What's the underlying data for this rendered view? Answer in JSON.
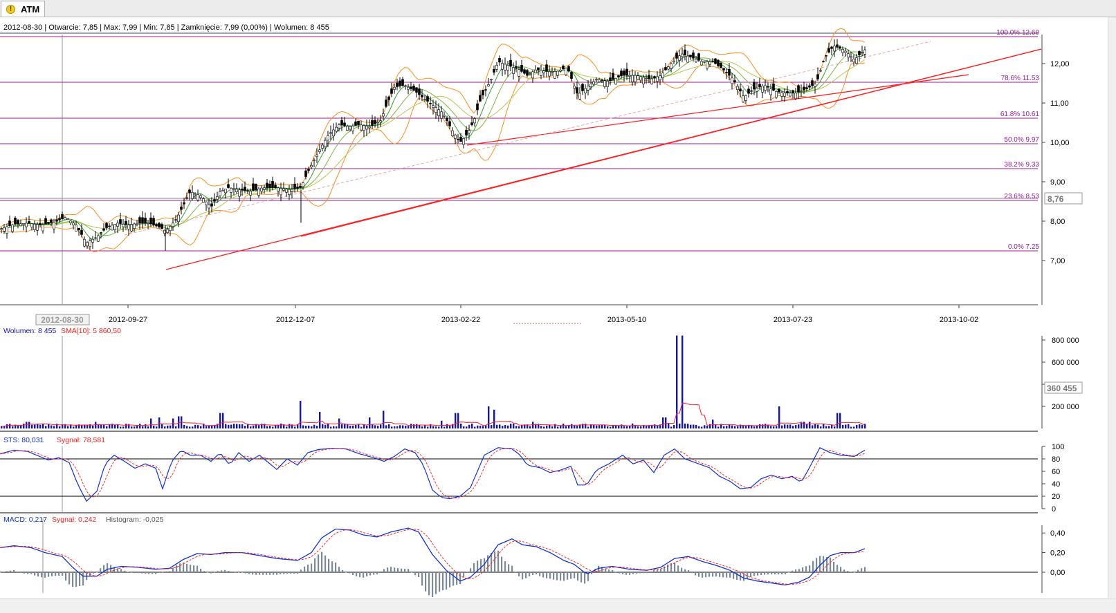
{
  "tab": {
    "label": "ATM",
    "icon": "warning-icon"
  },
  "info_bar": "2012-08-30 | Otwarcie: 7,85 | Max: 7,99 | Min: 7,85 | Zamknięcie: 7,99 (0,00%) | Wolumen: 8 455",
  "colors": {
    "fib": "#9b1b9b",
    "trend": "#ff2020",
    "bollinger": "#ff8c1a",
    "ma_fast": "#2aa02a",
    "ma_slow": "#b9c64b",
    "volume": "#1010d0",
    "sts": "#1030e0",
    "signal": "#ff2020",
    "histogram": "#7a8a9a"
  },
  "chart_data": [
    {
      "type": "candlestick",
      "price_axis_labels": [
        "12,00",
        "11,00",
        "10,00",
        "9,00",
        "8,00",
        "7,00"
      ],
      "current_price_label": "8,76",
      "ylim": [
        6.9,
        13.0
      ],
      "date_labels": [
        "2012-09-27",
        "2012-12-07",
        "2013-02-22",
        "2013-05-10",
        "2013-07-23",
        "2013-10-02"
      ],
      "cursor_date_label": "2012-08-30",
      "fibonacci": [
        {
          "label": "100.0% 12.69",
          "value": 12.69
        },
        {
          "label": "78.6% 11.53",
          "value": 11.53
        },
        {
          "label": "61.8% 10.61",
          "value": 10.61
        },
        {
          "label": "50.0% 9.97",
          "value": 9.97
        },
        {
          "label": "38.2% 9.33",
          "value": 9.33
        },
        {
          "label": "23.6% 8.53",
          "value": 8.53
        },
        {
          "label": "0.0% 7.25",
          "value": 7.25
        }
      ],
      "close_path": [
        [
          0,
          7.8
        ],
        [
          20,
          7.92
        ],
        [
          40,
          7.95
        ],
        [
          60,
          7.9
        ],
        [
          80,
          7.98
        ],
        [
          95,
          8.1
        ],
        [
          110,
          7.9
        ],
        [
          125,
          7.45
        ],
        [
          140,
          7.6
        ],
        [
          155,
          7.85
        ],
        [
          170,
          7.95
        ],
        [
          185,
          7.9
        ],
        [
          200,
          7.95
        ],
        [
          215,
          7.95
        ],
        [
          230,
          7.85
        ],
        [
          240,
          7.75
        ],
        [
          255,
          8.05
        ],
        [
          265,
          8.4
        ],
        [
          275,
          8.75
        ],
        [
          290,
          8.65
        ],
        [
          305,
          8.35
        ],
        [
          318,
          8.75
        ],
        [
          330,
          8.85
        ],
        [
          345,
          8.8
        ],
        [
          360,
          8.75
        ],
        [
          380,
          8.85
        ],
        [
          400,
          8.85
        ],
        [
          420,
          8.8
        ],
        [
          435,
          8.85
        ],
        [
          445,
          9.25
        ],
        [
          460,
          9.75
        ],
        [
          475,
          10.2
        ],
        [
          490,
          10.45
        ],
        [
          505,
          10.4
        ],
        [
          520,
          10.45
        ],
        [
          535,
          10.4
        ],
        [
          550,
          10.55
        ],
        [
          560,
          11.0
        ],
        [
          570,
          11.4
        ],
        [
          585,
          11.45
        ],
        [
          600,
          11.3
        ],
        [
          610,
          11.15
        ],
        [
          625,
          10.95
        ],
        [
          640,
          10.75
        ],
        [
          652,
          10.35
        ],
        [
          665,
          10.0
        ],
        [
          675,
          10.2
        ],
        [
          685,
          10.55
        ],
        [
          695,
          11.1
        ],
        [
          710,
          11.6
        ],
        [
          720,
          12.05
        ],
        [
          735,
          11.95
        ],
        [
          750,
          11.85
        ],
        [
          762,
          11.7
        ],
        [
          775,
          11.85
        ],
        [
          790,
          11.8
        ],
        [
          805,
          11.8
        ],
        [
          820,
          11.9
        ],
        [
          835,
          11.2
        ],
        [
          848,
          11.4
        ],
        [
          862,
          11.6
        ],
        [
          880,
          11.55
        ],
        [
          900,
          11.7
        ],
        [
          920,
          11.7
        ],
        [
          940,
          11.6
        ],
        [
          955,
          11.7
        ],
        [
          970,
          12.0
        ],
        [
          985,
          12.25
        ],
        [
          1000,
          12.15
        ],
        [
          1015,
          12.05
        ],
        [
          1030,
          12.05
        ],
        [
          1045,
          11.85
        ],
        [
          1060,
          11.6
        ],
        [
          1075,
          11.15
        ],
        [
          1090,
          11.35
        ],
        [
          1105,
          11.45
        ],
        [
          1120,
          11.3
        ],
        [
          1135,
          11.25
        ],
        [
          1150,
          11.25
        ],
        [
          1165,
          11.35
        ],
        [
          1180,
          11.5
        ],
        [
          1192,
          12.15
        ],
        [
          1205,
          12.45
        ],
        [
          1220,
          12.35
        ],
        [
          1235,
          12.1
        ],
        [
          1250,
          12.35
        ]
      ],
      "last_bar": {
        "date": "2012-08-30",
        "open": "7,85",
        "high": "7,99",
        "low": "7,85",
        "close": "7,99 (0,00%)"
      }
    },
    {
      "type": "bar",
      "title": "Wolumen: 8 455",
      "indicator": "SMA[10]: 5 860,50",
      "axis_labels": [
        "800 000",
        "600 000",
        "400 000",
        "200 000"
      ],
      "current_label": "360 455",
      "ylim": [
        0,
        800000
      ],
      "spikes": [
        [
          40,
          60000
        ],
        [
          95,
          40000
        ],
        [
          138,
          60000
        ],
        [
          218,
          90000
        ],
        [
          230,
          100000
        ],
        [
          250,
          90000
        ],
        [
          260,
          110000
        ],
        [
          320,
          140000
        ],
        [
          435,
          250000
        ],
        [
          462,
          150000
        ],
        [
          490,
          90000
        ],
        [
          535,
          100000
        ],
        [
          555,
          160000
        ],
        [
          638,
          70000
        ],
        [
          660,
          140000
        ],
        [
          705,
          200000
        ],
        [
          715,
          170000
        ],
        [
          770,
          60000
        ],
        [
          960,
          100000
        ],
        [
          977,
          840000
        ],
        [
          987,
          840000
        ],
        [
          1030,
          80000
        ],
        [
          1125,
          200000
        ],
        [
          1160,
          60000
        ],
        [
          1170,
          60000
        ],
        [
          1212,
          140000
        ]
      ]
    },
    {
      "type": "line",
      "title": "STS: 80,031",
      "signal": "Sygnał: 78,581",
      "axis_labels": [
        "100",
        "80",
        "60",
        "40",
        "20",
        "0"
      ],
      "ylim": [
        0,
        100
      ],
      "levels": [
        80,
        20
      ],
      "points": [
        [
          0,
          88
        ],
        [
          20,
          94
        ],
        [
          40,
          92
        ],
        [
          55,
          85
        ],
        [
          70,
          78
        ],
        [
          85,
          82
        ],
        [
          100,
          74
        ],
        [
          112,
          40
        ],
        [
          125,
          12
        ],
        [
          140,
          28
        ],
        [
          152,
          72
        ],
        [
          165,
          86
        ],
        [
          180,
          76
        ],
        [
          195,
          65
        ],
        [
          210,
          72
        ],
        [
          225,
          65
        ],
        [
          235,
          32
        ],
        [
          248,
          76
        ],
        [
          262,
          94
        ],
        [
          275,
          86
        ],
        [
          290,
          86
        ],
        [
          305,
          76
        ],
        [
          318,
          90
        ],
        [
          332,
          70
        ],
        [
          345,
          90
        ],
        [
          360,
          76
        ],
        [
          375,
          86
        ],
        [
          388,
          74
        ],
        [
          400,
          63
        ],
        [
          415,
          80
        ],
        [
          430,
          70
        ],
        [
          445,
          90
        ],
        [
          460,
          95
        ],
        [
          480,
          97
        ],
        [
          500,
          96
        ],
        [
          520,
          88
        ],
        [
          540,
          82
        ],
        [
          555,
          76
        ],
        [
          570,
          84
        ],
        [
          585,
          96
        ],
        [
          600,
          90
        ],
        [
          612,
          70
        ],
        [
          625,
          30
        ],
        [
          638,
          18
        ],
        [
          650,
          16
        ],
        [
          665,
          20
        ],
        [
          680,
          34
        ],
        [
          690,
          60
        ],
        [
          700,
          86
        ],
        [
          720,
          98
        ],
        [
          740,
          96
        ],
        [
          752,
          86
        ],
        [
          762,
          70
        ],
        [
          780,
          66
        ],
        [
          795,
          58
        ],
        [
          810,
          62
        ],
        [
          825,
          68
        ],
        [
          835,
          38
        ],
        [
          848,
          38
        ],
        [
          862,
          62
        ],
        [
          880,
          72
        ],
        [
          900,
          86
        ],
        [
          915,
          72
        ],
        [
          930,
          78
        ],
        [
          945,
          58
        ],
        [
          960,
          86
        ],
        [
          975,
          96
        ],
        [
          990,
          80
        ],
        [
          1010,
          72
        ],
        [
          1025,
          66
        ],
        [
          1040,
          52
        ],
        [
          1055,
          44
        ],
        [
          1070,
          32
        ],
        [
          1085,
          34
        ],
        [
          1100,
          48
        ],
        [
          1115,
          54
        ],
        [
          1130,
          48
        ],
        [
          1145,
          52
        ],
        [
          1158,
          42
        ],
        [
          1170,
          66
        ],
        [
          1185,
          98
        ],
        [
          1200,
          90
        ],
        [
          1215,
          86
        ],
        [
          1235,
          84
        ],
        [
          1250,
          94
        ]
      ]
    },
    {
      "type": "line",
      "title": "MACD: 0,217",
      "signal": "Sygnał: 0,242",
      "histogram": "Histogram: -0,025",
      "axis_labels": [
        "0,40",
        "0,20",
        "0,00"
      ],
      "ylim": [
        -0.15,
        0.45
      ],
      "points": [
        [
          0,
          0.25
        ],
        [
          20,
          0.27
        ],
        [
          45,
          0.25
        ],
        [
          65,
          0.2
        ],
        [
          90,
          0.16
        ],
        [
          105,
          0.05
        ],
        [
          120,
          -0.04
        ],
        [
          140,
          -0.04
        ],
        [
          155,
          0.03
        ],
        [
          175,
          0.06
        ],
        [
          200,
          0.05
        ],
        [
          225,
          0.03
        ],
        [
          245,
          0.04
        ],
        [
          265,
          0.13
        ],
        [
          285,
          0.19
        ],
        [
          305,
          0.18
        ],
        [
          325,
          0.2
        ],
        [
          350,
          0.2
        ],
        [
          375,
          0.17
        ],
        [
          400,
          0.14
        ],
        [
          430,
          0.12
        ],
        [
          450,
          0.2
        ],
        [
          465,
          0.35
        ],
        [
          485,
          0.44
        ],
        [
          505,
          0.43
        ],
        [
          525,
          0.38
        ],
        [
          545,
          0.36
        ],
        [
          565,
          0.41
        ],
        [
          590,
          0.45
        ],
        [
          605,
          0.41
        ],
        [
          625,
          0.18
        ],
        [
          645,
          0.02
        ],
        [
          665,
          -0.09
        ],
        [
          680,
          -0.05
        ],
        [
          700,
          0.08
        ],
        [
          720,
          0.28
        ],
        [
          740,
          0.34
        ],
        [
          755,
          0.28
        ],
        [
          775,
          0.26
        ],
        [
          795,
          0.2
        ],
        [
          815,
          0.12
        ],
        [
          830,
          0.08
        ],
        [
          848,
          -0.02
        ],
        [
          865,
          0.04
        ],
        [
          885,
          0.06
        ],
        [
          910,
          0.03
        ],
        [
          935,
          0.02
        ],
        [
          955,
          0.05
        ],
        [
          975,
          0.14
        ],
        [
          995,
          0.16
        ],
        [
          1015,
          0.11
        ],
        [
          1035,
          0.07
        ],
        [
          1055,
          0.02
        ],
        [
          1075,
          -0.06
        ],
        [
          1095,
          -0.09
        ],
        [
          1115,
          -0.11
        ],
        [
          1135,
          -0.13
        ],
        [
          1155,
          -0.1
        ],
        [
          1170,
          -0.05
        ],
        [
          1185,
          0.07
        ],
        [
          1200,
          0.17
        ],
        [
          1215,
          0.2
        ],
        [
          1235,
          0.2
        ],
        [
          1250,
          0.24
        ]
      ]
    }
  ]
}
